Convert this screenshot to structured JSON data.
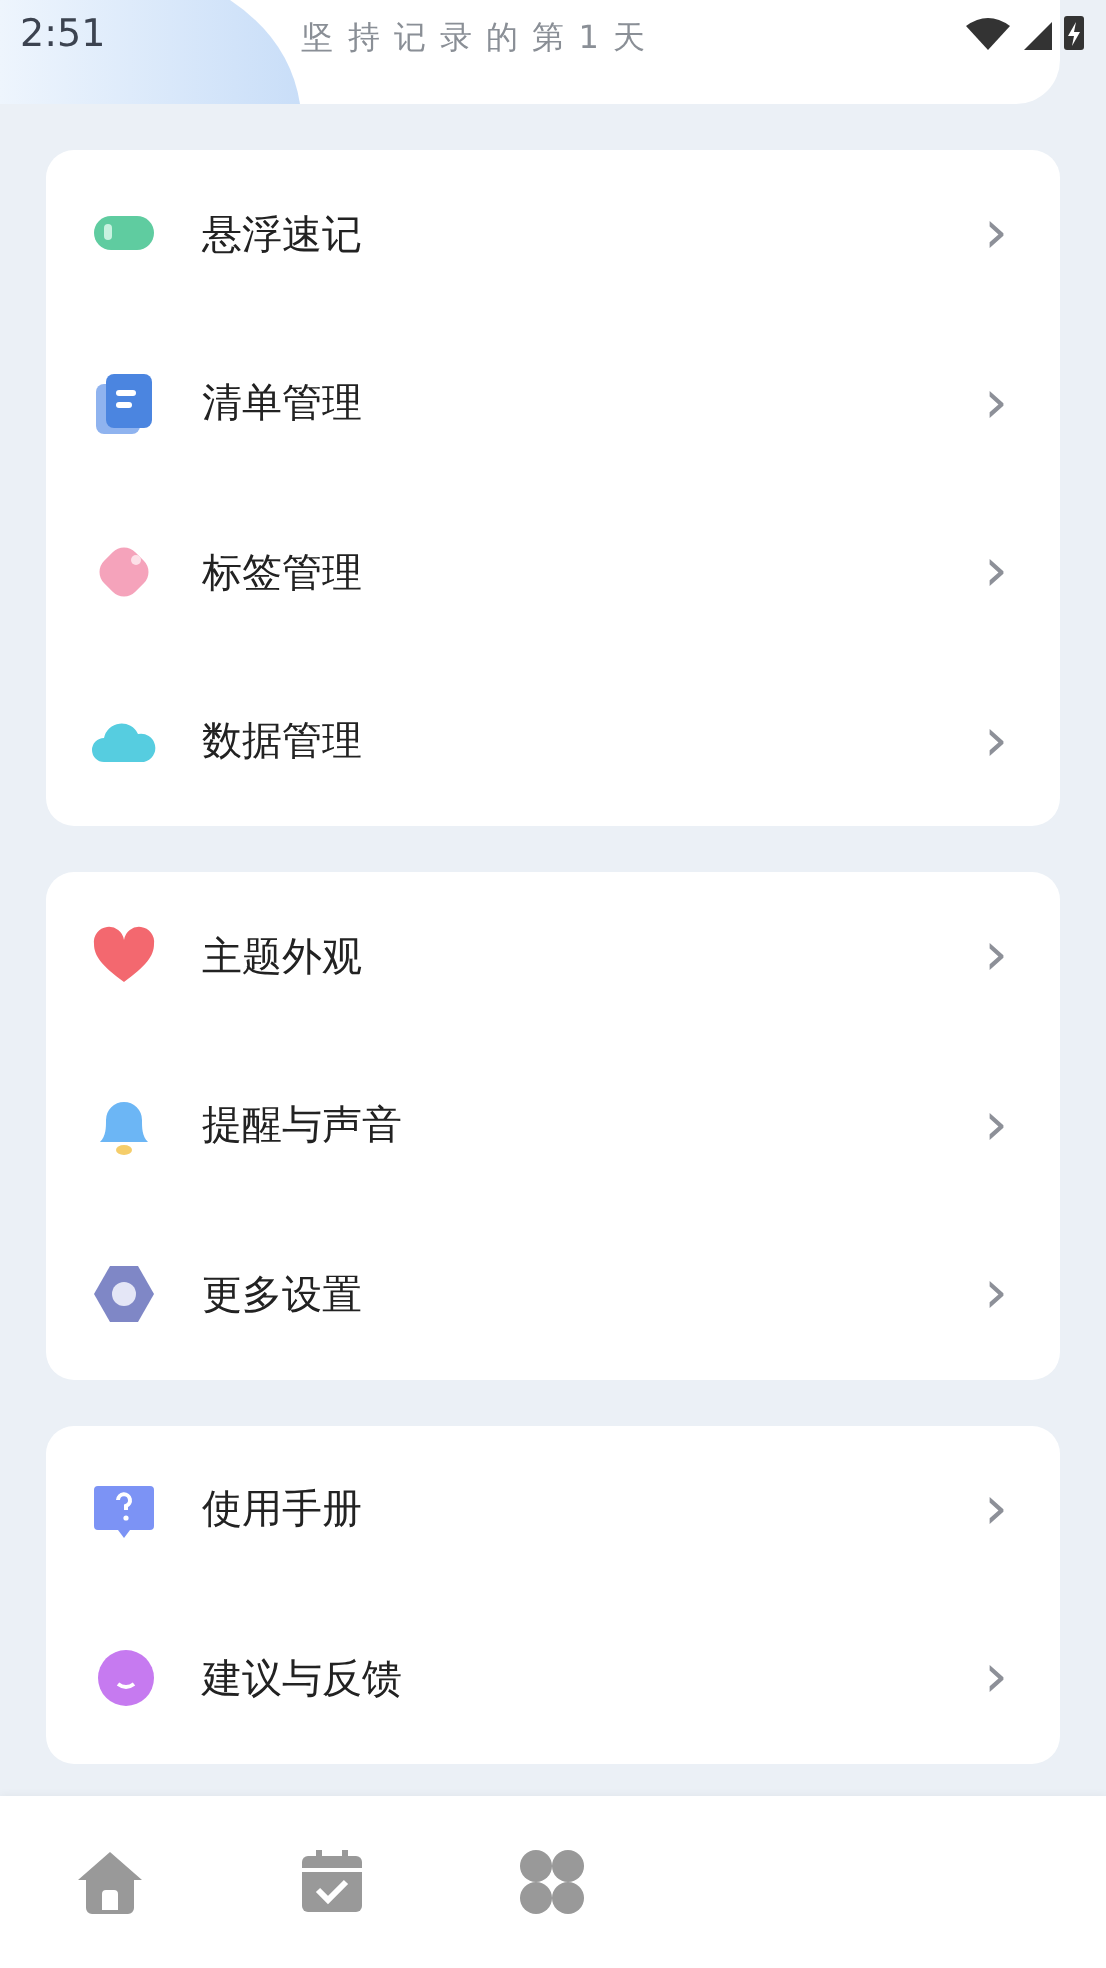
{
  "status_bar": {
    "time": "2:51"
  },
  "header": {
    "streak": "坚 持 记 录 的 第 1 天"
  },
  "sections": [
    {
      "items": [
        {
          "kind": "float",
          "label": "悬浮速记",
          "chevron": "›"
        },
        {
          "kind": "list",
          "label": "清单管理",
          "chevron": "›"
        },
        {
          "kind": "tag",
          "label": "标签管理",
          "chevron": "›"
        },
        {
          "kind": "cloud",
          "label": "数据管理",
          "chevron": "›"
        }
      ]
    },
    {
      "items": [
        {
          "kind": "heart",
          "label": "主题外观",
          "chevron": "›"
        },
        {
          "kind": "bell",
          "label": "提醒与声音",
          "chevron": "›"
        },
        {
          "kind": "gear",
          "label": "更多设置",
          "chevron": "›"
        }
      ]
    },
    {
      "items": [
        {
          "kind": "help",
          "label": "使用手册",
          "chevron": "›"
        },
        {
          "kind": "chat",
          "label": "建议与反馈",
          "chevron": "›"
        }
      ]
    }
  ],
  "nav": [
    {
      "kind": "home"
    },
    {
      "kind": "calendar"
    },
    {
      "kind": "apps"
    }
  ]
}
